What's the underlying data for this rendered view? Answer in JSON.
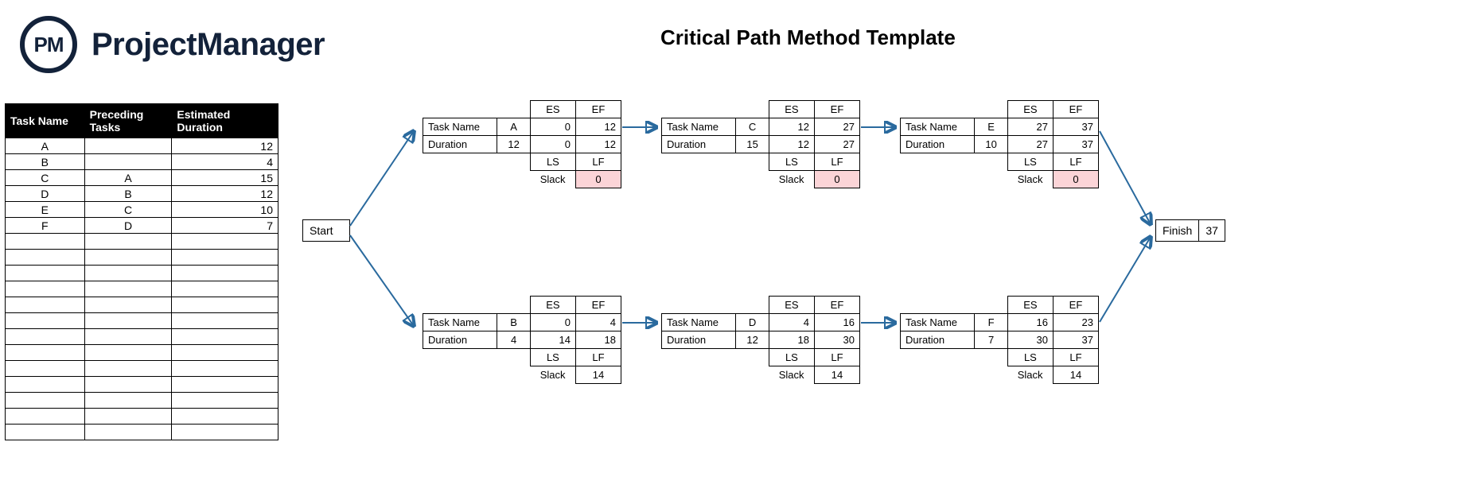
{
  "logo": {
    "badge": "PM",
    "brand": "ProjectManager"
  },
  "title": "Critical Path Method Template",
  "table": {
    "headers": [
      "Task Name",
      "Preceding Tasks",
      "Estimated Duration"
    ],
    "rows": [
      {
        "name": "A",
        "pred": "",
        "dur": "12"
      },
      {
        "name": "B",
        "pred": "",
        "dur": "4"
      },
      {
        "name": "C",
        "pred": "A",
        "dur": "15"
      },
      {
        "name": "D",
        "pred": "B",
        "dur": "12"
      },
      {
        "name": "E",
        "pred": "C",
        "dur": "10"
      },
      {
        "name": "F",
        "pred": "D",
        "dur": "7"
      }
    ],
    "blank_rows": 13
  },
  "labels": {
    "start": "Start",
    "finish": "Finish",
    "taskname": "Task Name",
    "duration": "Duration",
    "es": "ES",
    "ef": "EF",
    "ls": "LS",
    "lf": "LF",
    "slack": "Slack"
  },
  "finish_value": "37",
  "nodes": {
    "A": {
      "task": "A",
      "dur": "12",
      "es": "0",
      "ef": "12",
      "ls": "0",
      "lf": "12",
      "slack": "0",
      "critical": true
    },
    "B": {
      "task": "B",
      "dur": "4",
      "es": "0",
      "ef": "4",
      "ls": "14",
      "lf": "18",
      "slack": "14",
      "critical": false
    },
    "C": {
      "task": "C",
      "dur": "15",
      "es": "12",
      "ef": "27",
      "ls": "12",
      "lf": "27",
      "slack": "0",
      "critical": true
    },
    "D": {
      "task": "D",
      "dur": "12",
      "es": "4",
      "ef": "16",
      "ls": "18",
      "lf": "30",
      "slack": "14",
      "critical": false
    },
    "E": {
      "task": "E",
      "dur": "10",
      "es": "27",
      "ef": "37",
      "ls": "27",
      "lf": "37",
      "slack": "0",
      "critical": true
    },
    "F": {
      "task": "F",
      "dur": "7",
      "es": "16",
      "ef": "23",
      "ls": "30",
      "lf": "37",
      "slack": "14",
      "critical": false
    }
  }
}
